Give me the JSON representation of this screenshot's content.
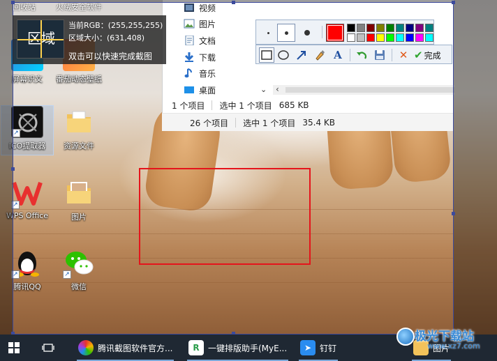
{
  "desktop": {
    "top_labels": [
      "回收站",
      "火绒安全软件"
    ],
    "icons": [
      {
        "label": "屏幕识文"
      },
      {
        "label": "番茄动态壁纸"
      },
      {
        "label": "ICO提取器"
      },
      {
        "label": "资源文件"
      },
      {
        "label": "WPS Office"
      },
      {
        "label": "图片"
      },
      {
        "label": "腾讯QQ"
      },
      {
        "label": "微信"
      }
    ]
  },
  "capture_info": {
    "magnifier_text": "区域",
    "rgb_label": "当前RGB：",
    "rgb_value": "(255,255,255)",
    "size_label": "区域大小：",
    "size_value": "(631,408)",
    "hint": "双击可以快速完成截图"
  },
  "explorer": {
    "nav_items": [
      "视频",
      "图片",
      "文档",
      "下载",
      "音乐",
      "桌面"
    ],
    "status_primary": {
      "count": "1 个项目",
      "selected": "选中 1 个项目",
      "size": "685 KB"
    },
    "status_secondary": {
      "count": "26 个项目",
      "selected": "选中 1 个项目",
      "size": "35.4 KB"
    }
  },
  "toolbar": {
    "selected_color": "#ff0000",
    "palette": [
      "#000000",
      "#808080",
      "#800000",
      "#808000",
      "#008000",
      "#008080",
      "#000080",
      "#800080",
      "#008080",
      "#ffffff",
      "#c0c0c0",
      "#ff0000",
      "#ffff00",
      "#00ff00",
      "#00ffff",
      "#0000ff",
      "#ff00ff",
      "#00ffff"
    ],
    "tools": [
      "rectangle-tool",
      "ellipse-tool",
      "arrow-tool",
      "brush-tool",
      "text-tool",
      "undo",
      "save",
      "cancel"
    ],
    "done_label": "完成"
  },
  "taskbar": {
    "items": [
      {
        "label": "腾讯截图软件官方..."
      },
      {
        "label": "一键排版助手(MyE..."
      },
      {
        "label": "钉钉"
      },
      {
        "label": "图片"
      }
    ]
  },
  "watermark": {
    "text": "极光下载站",
    "url": "www.xz7.com"
  }
}
